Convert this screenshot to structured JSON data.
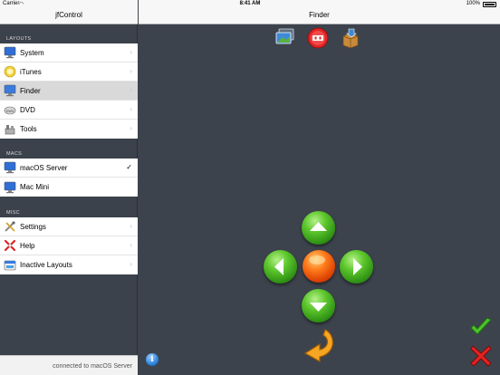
{
  "status": {
    "carrier": "Carrier",
    "time": "8:41 AM",
    "battery": "100%"
  },
  "sidebar": {
    "title": "jfControl",
    "sections": [
      {
        "label": "LAYOUTS",
        "items": [
          {
            "label": "System",
            "icon": "monitor-icon",
            "accessory": "chevron"
          },
          {
            "label": "iTunes",
            "icon": "itunes-icon",
            "accessory": "chevron"
          },
          {
            "label": "Finder",
            "icon": "finder-icon",
            "accessory": "chevron",
            "selected": true
          },
          {
            "label": "DVD",
            "icon": "dvd-icon",
            "accessory": "chevron"
          },
          {
            "label": "Tools",
            "icon": "tools-icon",
            "accessory": "chevron"
          }
        ]
      },
      {
        "label": "MACS",
        "items": [
          {
            "label": "macOS Server",
            "icon": "monitor-icon",
            "accessory": "checkmark"
          },
          {
            "label": "Mac Mini",
            "icon": "monitor-icon",
            "accessory": "none"
          }
        ]
      },
      {
        "label": "MISC",
        "items": [
          {
            "label": "Settings",
            "icon": "settings-icon",
            "accessory": "chevron"
          },
          {
            "label": "Help",
            "icon": "help-icon",
            "accessory": "chevron"
          },
          {
            "label": "Inactive Layouts",
            "icon": "inactive-layouts-icon",
            "accessory": "chevron"
          }
        ]
      }
    ],
    "footer": "connected to macOS Server"
  },
  "main": {
    "title": "Finder",
    "toolbar_icons": [
      "desktop-icon",
      "quit-apps-icon",
      "install-package-icon"
    ],
    "dpad": [
      "up-arrow-icon",
      "left-arrow-icon",
      "center-icon",
      "right-arrow-icon",
      "down-arrow-icon"
    ],
    "colors": {
      "accent_green": "#3aa91b",
      "accent_orange": "#ff7a1a",
      "background": "#3d434d"
    }
  }
}
